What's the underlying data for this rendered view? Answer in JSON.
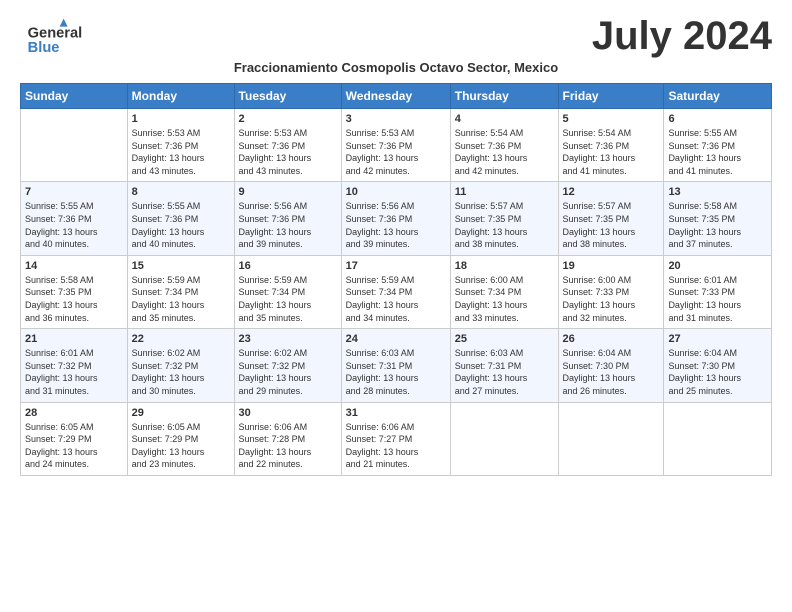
{
  "header": {
    "logo_general": "General",
    "logo_blue": "Blue",
    "month": "July 2024",
    "subtitle": "Fraccionamiento Cosmopolis Octavo Sector, Mexico"
  },
  "days_of_week": [
    "Sunday",
    "Monday",
    "Tuesday",
    "Wednesday",
    "Thursday",
    "Friday",
    "Saturday"
  ],
  "weeks": [
    [
      {
        "date": "",
        "info": ""
      },
      {
        "date": "1",
        "info": "Sunrise: 5:53 AM\nSunset: 7:36 PM\nDaylight: 13 hours\nand 43 minutes."
      },
      {
        "date": "2",
        "info": "Sunrise: 5:53 AM\nSunset: 7:36 PM\nDaylight: 13 hours\nand 43 minutes."
      },
      {
        "date": "3",
        "info": "Sunrise: 5:53 AM\nSunset: 7:36 PM\nDaylight: 13 hours\nand 42 minutes."
      },
      {
        "date": "4",
        "info": "Sunrise: 5:54 AM\nSunset: 7:36 PM\nDaylight: 13 hours\nand 42 minutes."
      },
      {
        "date": "5",
        "info": "Sunrise: 5:54 AM\nSunset: 7:36 PM\nDaylight: 13 hours\nand 41 minutes."
      },
      {
        "date": "6",
        "info": "Sunrise: 5:55 AM\nSunset: 7:36 PM\nDaylight: 13 hours\nand 41 minutes."
      }
    ],
    [
      {
        "date": "7",
        "info": "Sunrise: 5:55 AM\nSunset: 7:36 PM\nDaylight: 13 hours\nand 40 minutes."
      },
      {
        "date": "8",
        "info": "Sunrise: 5:55 AM\nSunset: 7:36 PM\nDaylight: 13 hours\nand 40 minutes."
      },
      {
        "date": "9",
        "info": "Sunrise: 5:56 AM\nSunset: 7:36 PM\nDaylight: 13 hours\nand 39 minutes."
      },
      {
        "date": "10",
        "info": "Sunrise: 5:56 AM\nSunset: 7:36 PM\nDaylight: 13 hours\nand 39 minutes."
      },
      {
        "date": "11",
        "info": "Sunrise: 5:57 AM\nSunset: 7:35 PM\nDaylight: 13 hours\nand 38 minutes."
      },
      {
        "date": "12",
        "info": "Sunrise: 5:57 AM\nSunset: 7:35 PM\nDaylight: 13 hours\nand 38 minutes."
      },
      {
        "date": "13",
        "info": "Sunrise: 5:58 AM\nSunset: 7:35 PM\nDaylight: 13 hours\nand 37 minutes."
      }
    ],
    [
      {
        "date": "14",
        "info": "Sunrise: 5:58 AM\nSunset: 7:35 PM\nDaylight: 13 hours\nand 36 minutes."
      },
      {
        "date": "15",
        "info": "Sunrise: 5:59 AM\nSunset: 7:34 PM\nDaylight: 13 hours\nand 35 minutes."
      },
      {
        "date": "16",
        "info": "Sunrise: 5:59 AM\nSunset: 7:34 PM\nDaylight: 13 hours\nand 35 minutes."
      },
      {
        "date": "17",
        "info": "Sunrise: 5:59 AM\nSunset: 7:34 PM\nDaylight: 13 hours\nand 34 minutes."
      },
      {
        "date": "18",
        "info": "Sunrise: 6:00 AM\nSunset: 7:34 PM\nDaylight: 13 hours\nand 33 minutes."
      },
      {
        "date": "19",
        "info": "Sunrise: 6:00 AM\nSunset: 7:33 PM\nDaylight: 13 hours\nand 32 minutes."
      },
      {
        "date": "20",
        "info": "Sunrise: 6:01 AM\nSunset: 7:33 PM\nDaylight: 13 hours\nand 31 minutes."
      }
    ],
    [
      {
        "date": "21",
        "info": "Sunrise: 6:01 AM\nSunset: 7:32 PM\nDaylight: 13 hours\nand 31 minutes."
      },
      {
        "date": "22",
        "info": "Sunrise: 6:02 AM\nSunset: 7:32 PM\nDaylight: 13 hours\nand 30 minutes."
      },
      {
        "date": "23",
        "info": "Sunrise: 6:02 AM\nSunset: 7:32 PM\nDaylight: 13 hours\nand 29 minutes."
      },
      {
        "date": "24",
        "info": "Sunrise: 6:03 AM\nSunset: 7:31 PM\nDaylight: 13 hours\nand 28 minutes."
      },
      {
        "date": "25",
        "info": "Sunrise: 6:03 AM\nSunset: 7:31 PM\nDaylight: 13 hours\nand 27 minutes."
      },
      {
        "date": "26",
        "info": "Sunrise: 6:04 AM\nSunset: 7:30 PM\nDaylight: 13 hours\nand 26 minutes."
      },
      {
        "date": "27",
        "info": "Sunrise: 6:04 AM\nSunset: 7:30 PM\nDaylight: 13 hours\nand 25 minutes."
      }
    ],
    [
      {
        "date": "28",
        "info": "Sunrise: 6:05 AM\nSunset: 7:29 PM\nDaylight: 13 hours\nand 24 minutes."
      },
      {
        "date": "29",
        "info": "Sunrise: 6:05 AM\nSunset: 7:29 PM\nDaylight: 13 hours\nand 23 minutes."
      },
      {
        "date": "30",
        "info": "Sunrise: 6:06 AM\nSunset: 7:28 PM\nDaylight: 13 hours\nand 22 minutes."
      },
      {
        "date": "31",
        "info": "Sunrise: 6:06 AM\nSunset: 7:27 PM\nDaylight: 13 hours\nand 21 minutes."
      },
      {
        "date": "",
        "info": ""
      },
      {
        "date": "",
        "info": ""
      },
      {
        "date": "",
        "info": ""
      }
    ]
  ]
}
